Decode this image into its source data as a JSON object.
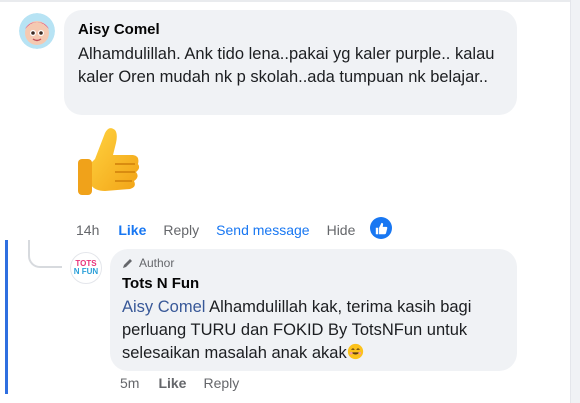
{
  "comment": {
    "author": "Aisy Comel",
    "text": "Alhamdulillah. Ank tido lena..pakai yg kaler purple.. kalau kaler Oren mudah nk p skolah..ada tumpuan nk belajar..",
    "time": "14h",
    "actions": {
      "like": "Like",
      "reply": "Reply",
      "send_message": "Send message",
      "hide": "Hide"
    }
  },
  "reply": {
    "badge": "Author",
    "author": "Tots N Fun",
    "mention": "Aisy Comel",
    "text": " Alhamdulillah kak, terima kasih bagi perluang TURU dan FOKID By TotsNFun untuk selesaikan masalah anak akak",
    "time": "5m",
    "actions": {
      "like": "Like",
      "reply": "Reply"
    }
  },
  "colors": {
    "link_blue": "#1877f2",
    "bubble_bg": "#f0f2f5",
    "thread_line": "#2f6fe0"
  },
  "icons": {
    "comment_sticker": "thumbs-up-icon",
    "reaction": "like-reaction-icon",
    "badge": "pen-icon",
    "emoji": "smiling-face-icon"
  }
}
